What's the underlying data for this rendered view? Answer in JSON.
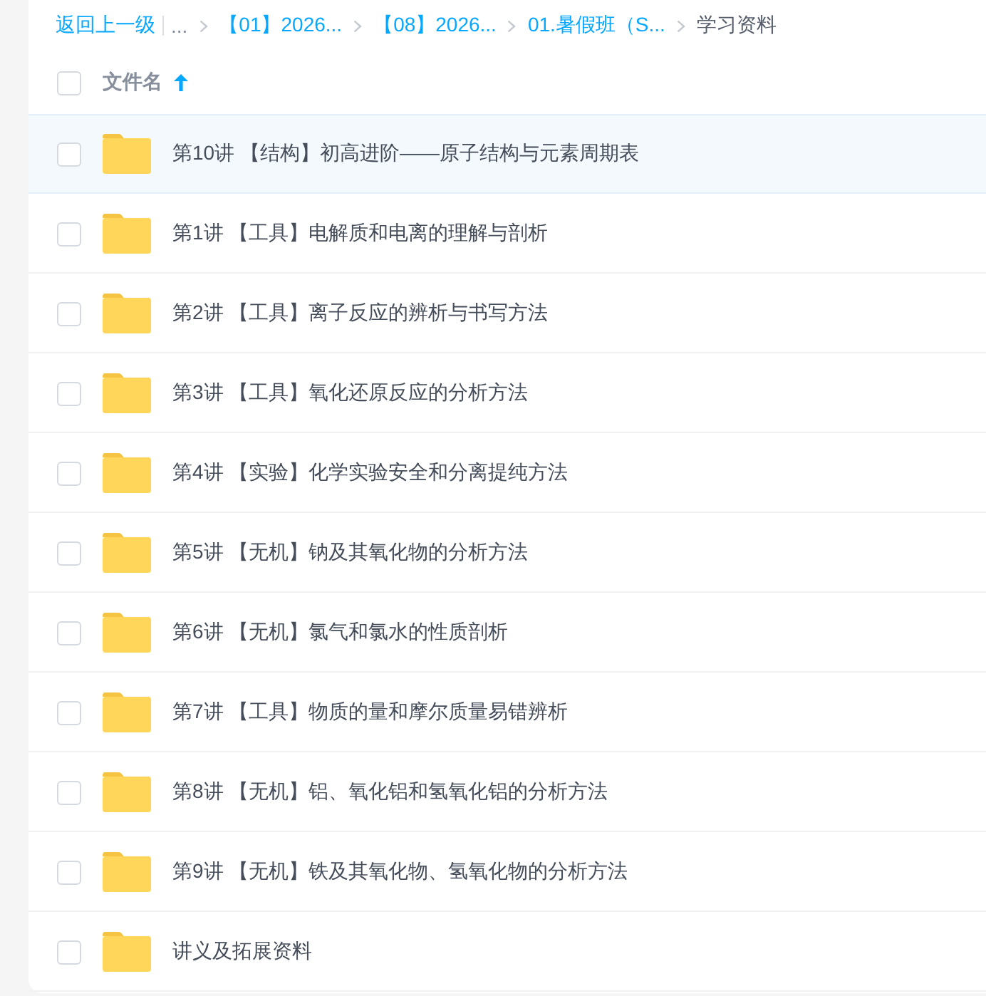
{
  "breadcrumb": {
    "back": "返回上一级",
    "items": [
      {
        "label": "...",
        "kind": "ellipsis"
      },
      {
        "label": "【01】2026...",
        "kind": "link"
      },
      {
        "label": "【08】2026...",
        "kind": "link"
      },
      {
        "label": "01.暑假班（S...",
        "kind": "link"
      },
      {
        "label": "学习资料",
        "kind": "current"
      }
    ]
  },
  "list_header": {
    "checked": false,
    "column": "文件名",
    "sort_ascending": true
  },
  "files": [
    {
      "name": "第10讲 【结构】初高进阶——原子结构与元素周期表",
      "kind": "folder",
      "checked": false,
      "highlighted": true
    },
    {
      "name": "第1讲 【工具】电解质和电离的理解与剖析",
      "kind": "folder",
      "checked": false,
      "highlighted": false
    },
    {
      "name": "第2讲 【工具】离子反应的辨析与书写方法",
      "kind": "folder",
      "checked": false,
      "highlighted": false
    },
    {
      "name": "第3讲 【工具】氧化还原反应的分析方法",
      "kind": "folder",
      "checked": false,
      "highlighted": false
    },
    {
      "name": "第4讲 【实验】化学实验安全和分离提纯方法",
      "kind": "folder",
      "checked": false,
      "highlighted": false
    },
    {
      "name": "第5讲 【无机】钠及其氧化物的分析方法",
      "kind": "folder",
      "checked": false,
      "highlighted": false
    },
    {
      "name": "第6讲 【无机】氯气和氯水的性质剖析",
      "kind": "folder",
      "checked": false,
      "highlighted": false
    },
    {
      "name": "第7讲 【工具】物质的量和摩尔质量易错辨析",
      "kind": "folder",
      "checked": false,
      "highlighted": false
    },
    {
      "name": "第8讲 【无机】铝、氧化铝和氢氧化铝的分析方法",
      "kind": "folder",
      "checked": false,
      "highlighted": false
    },
    {
      "name": "第9讲 【无机】铁及其氧化物、氢氧化物的分析方法",
      "kind": "folder",
      "checked": false,
      "highlighted": false
    },
    {
      "name": "讲义及拓展资料",
      "kind": "folder",
      "checked": false,
      "highlighted": false
    }
  ]
}
